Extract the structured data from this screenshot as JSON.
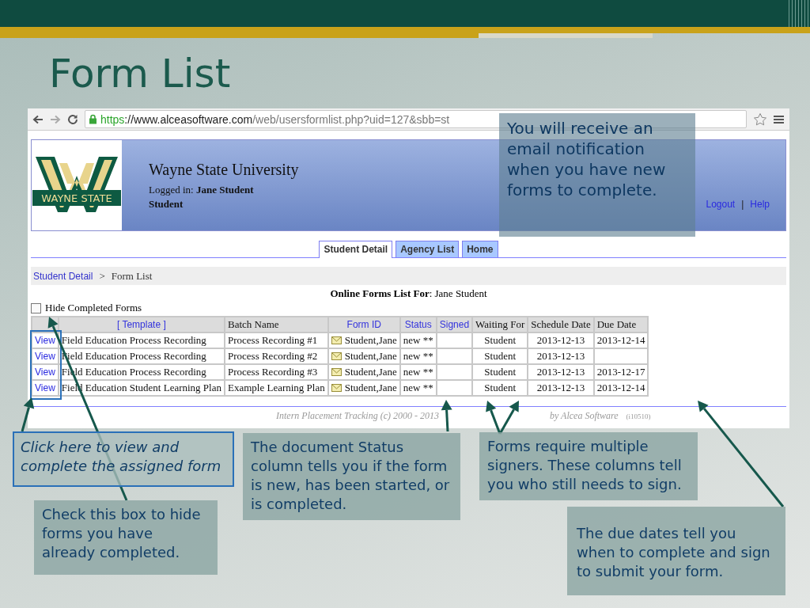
{
  "slide": {
    "title": "Form List"
  },
  "browser": {
    "url_parts": [
      {
        "kind": "scheme",
        "text": "https"
      },
      {
        "kind": "host",
        "text": "://www.alceasoftware.com"
      },
      {
        "kind": "path",
        "text": "/web/usersformlist.php?uid=127&sbb=st"
      }
    ]
  },
  "header": {
    "logo_text": "WAYNE STATE",
    "university": "Wayne State University",
    "logged_in": "Logged in: **Jane Student**",
    "role": "Student",
    "links": [
      "Logout",
      "Help"
    ],
    "link_separator": "|"
  },
  "tabs": [
    {
      "label": "Student Detail",
      "selected": true
    },
    {
      "label": "Agency List",
      "selected": false
    },
    {
      "label": "Home",
      "selected": false
    }
  ],
  "breadcrumb": {
    "link": "Student Detail",
    "separator": ">",
    "current": "Form List"
  },
  "heading": "**Online Forms List For**: Jane Student",
  "hide_completed": {
    "label": "Hide Completed Forms",
    "checked": false
  },
  "table": {
    "columns": [
      {
        "label": "[ Template ]",
        "sortable": true
      },
      {
        "label": "Batch Name",
        "sortable": false
      },
      {
        "label": "Form ID",
        "sortable": true
      },
      {
        "label": "Status",
        "sortable": true
      },
      {
        "label": "Signed",
        "sortable": true
      },
      {
        "label": "Waiting For",
        "sortable": false
      },
      {
        "label": "Schedule Date",
        "sortable": false
      },
      {
        "label": "Due Date",
        "sortable": false
      }
    ],
    "rows": [
      {
        "action": "View",
        "template": "Field Education Process Recording",
        "batch": "Process Recording #1",
        "form_id": "Student,Jane",
        "status": "new **",
        "waiting_for": "Student",
        "schedule_date": "2013-12-13",
        "due_date": "2013-12-14"
      },
      {
        "action": "View",
        "template": "Field Education Process Recording",
        "batch": "Process Recording #2",
        "form_id": "Student,Jane",
        "status": "new **",
        "waiting_for": "Student",
        "schedule_date": "2013-12-13"
      },
      {
        "action": "View",
        "template": "Field Education Process Recording",
        "batch": "Process Recording #3",
        "form_id": "Student,Jane",
        "status": "new **",
        "waiting_for": "Student",
        "schedule_date": "2013-12-13",
        "due_date": "2013-12-17"
      },
      {
        "action": "View",
        "template": "Field Education Student Learning Plan",
        "batch": "Example Learning Plan",
        "form_id": "Student,Jane",
        "status": "new **",
        "waiting_for": "Student",
        "schedule_date": "2013-12-13",
        "due_date": "2013-12-14"
      }
    ]
  },
  "footer": {
    "credit": "Intern Placement Tracking (c) 2000 - 2013",
    "vendor": "by Alcea Software",
    "code": "(i10510)"
  },
  "callouts": [
    {
      "kind": "note",
      "text": "You will receive an email notification when you have new forms to complete."
    },
    {
      "kind": "outlined",
      "text": "Click here to view and complete the assigned form"
    },
    {
      "kind": "note",
      "text": "Check this box to hide forms you have already completed."
    },
    {
      "kind": "note",
      "text": "The document Status column tells you if the form is new, has been started, or is completed."
    },
    {
      "kind": "note",
      "text": "Forms require multiple signers. These columns tell you who still needs to sign."
    },
    {
      "kind": "note",
      "text": "The due dates tell you when to complete and sign to submit your form."
    }
  ]
}
